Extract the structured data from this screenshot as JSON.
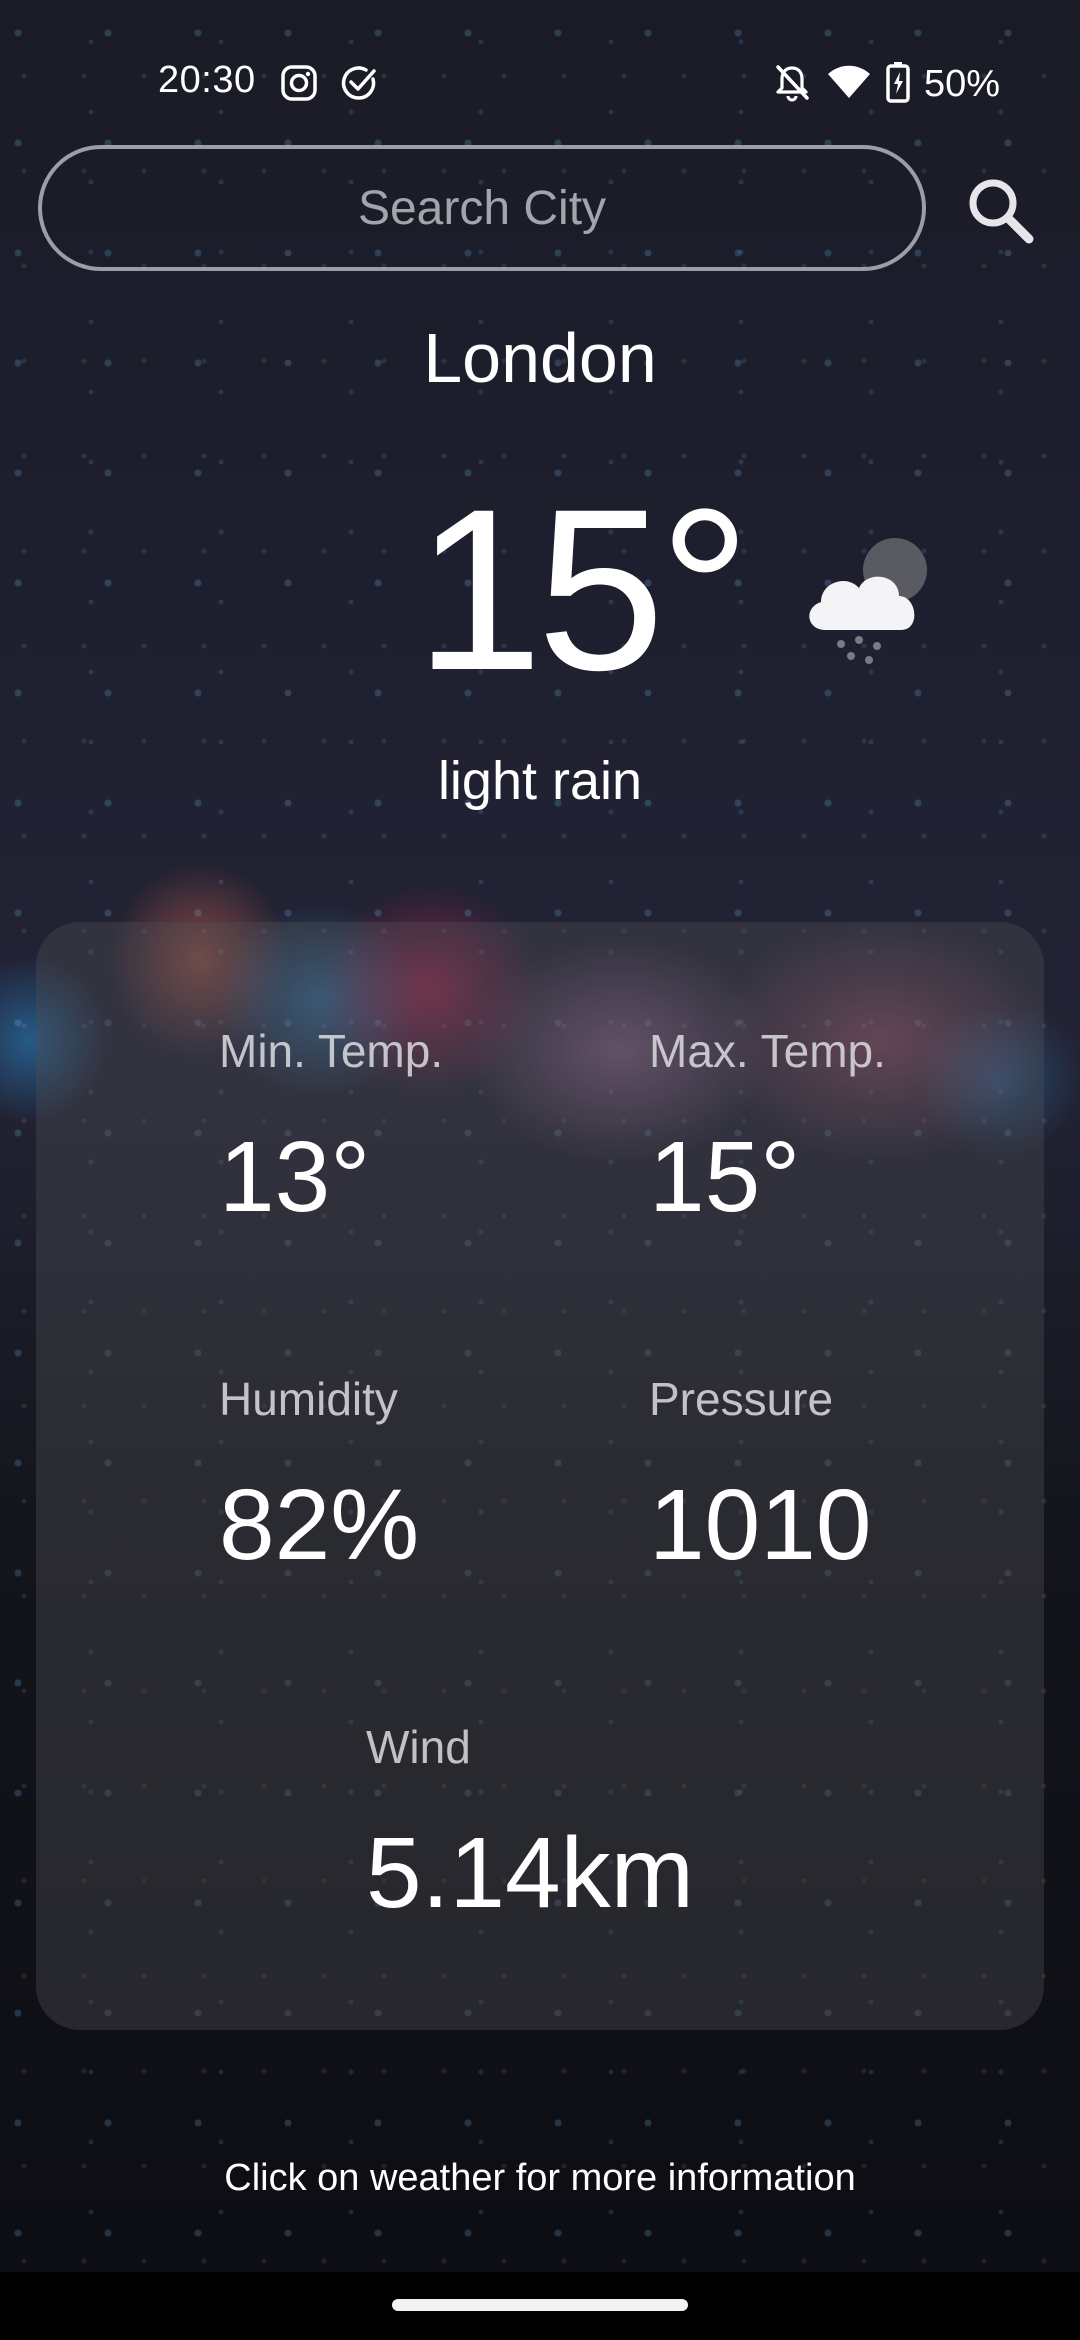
{
  "status_bar": {
    "time": "20:30",
    "battery": "50%",
    "icons": [
      "instagram-icon",
      "check-circle-icon",
      "bell-off-icon",
      "wifi-icon",
      "battery-charging-icon"
    ]
  },
  "search": {
    "placeholder": "Search City",
    "value": "",
    "icon": "search-icon"
  },
  "weather": {
    "city": "London",
    "temperature": "15°",
    "description": "light rain",
    "icon": "cloud-rain-icon"
  },
  "details": {
    "min_temp": {
      "label": "Min. Temp.",
      "value": "13°"
    },
    "max_temp": {
      "label": "Max. Temp.",
      "value": "15°"
    },
    "humidity": {
      "label": "Humidity",
      "value": "82%"
    },
    "pressure": {
      "label": "Pressure",
      "value": "1010"
    },
    "wind": {
      "label": "Wind",
      "value": "5.14km"
    }
  },
  "footer": {
    "hint": "Click on weather for more information"
  },
  "colors": {
    "text": "#ffffff",
    "label": "#d7d7dc",
    "card": "#505055",
    "nav_bar": "#000000"
  }
}
